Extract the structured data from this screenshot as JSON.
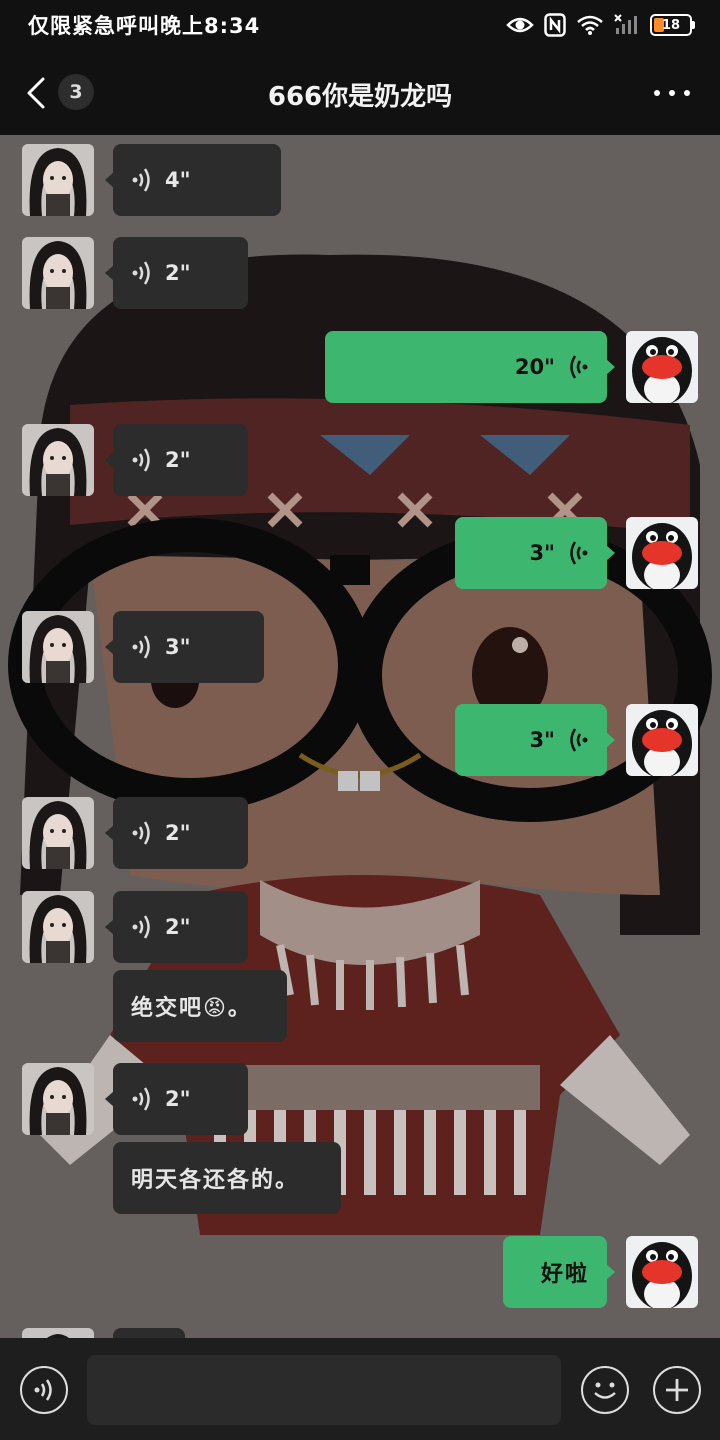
{
  "status_bar": {
    "text": "仅限紧急呼叫晚上8:34",
    "battery": "18",
    "icons": [
      "eye-icon",
      "nfc-icon",
      "wifi-icon",
      "signal-icon",
      "battery-icon"
    ]
  },
  "nav": {
    "title": "666你是奶龙吗",
    "unread_count": "3",
    "icons": [
      "back-icon",
      "more-icon"
    ]
  },
  "messages": [
    {
      "side": "left",
      "type": "voice",
      "duration": "4\""
    },
    {
      "side": "left",
      "type": "voice",
      "duration": "2\""
    },
    {
      "side": "right",
      "type": "voice",
      "duration": "20\""
    },
    {
      "side": "left",
      "type": "voice",
      "duration": "2\""
    },
    {
      "side": "right",
      "type": "voice",
      "duration": "3\""
    },
    {
      "side": "left",
      "type": "voice",
      "duration": "3\""
    },
    {
      "side": "right",
      "type": "voice",
      "duration": "3\""
    },
    {
      "side": "left",
      "type": "voice",
      "duration": "2\""
    },
    {
      "side": "left",
      "type": "voice",
      "duration": "2\""
    },
    {
      "side": "left",
      "type": "text",
      "text": "绝交吧😡。"
    },
    {
      "side": "left",
      "type": "voice",
      "duration": "2\""
    },
    {
      "side": "left",
      "type": "text",
      "text": "明天各还各的。"
    },
    {
      "side": "right",
      "type": "text",
      "text": "好啦"
    }
  ],
  "input_bar": {
    "placeholder": "",
    "icons": [
      "voice-input-icon",
      "emoji-icon",
      "plus-icon"
    ]
  },
  "colors": {
    "outgoing_bubble": "#3db66f",
    "incoming_bubble": "#2c2c2c",
    "background": "#111111"
  }
}
